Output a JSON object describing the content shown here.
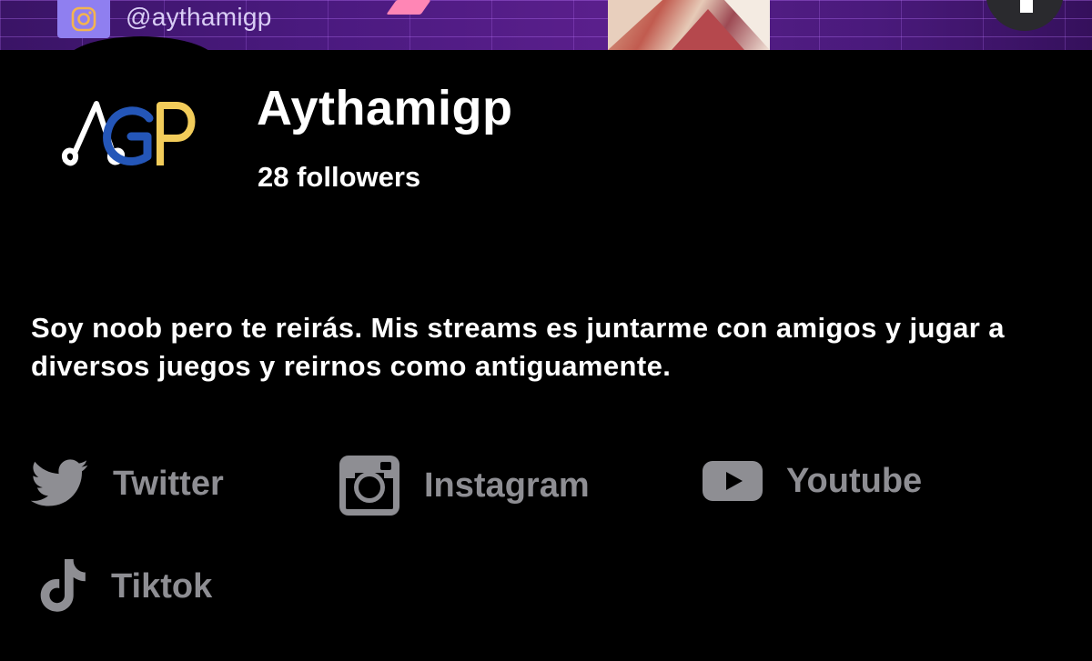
{
  "banner": {
    "instagram_handle": "@aythamigp",
    "colors": {
      "background": "#4b1a80",
      "instagram_tile": "#8f7ff0"
    }
  },
  "profile": {
    "logo_letters": "AGP",
    "name": "Aythamigp",
    "followers": "28 followers",
    "bio": "Soy noob pero te reirás. Mis streams es juntarme con amigos y jugar a diversos juegos y reirnos como antiguamente."
  },
  "socials": [
    {
      "label": "Twitter",
      "icon": "twitter-icon"
    },
    {
      "label": "Instagram",
      "icon": "instagram-icon"
    },
    {
      "label": "Youtube",
      "icon": "youtube-icon"
    },
    {
      "label": "Tiktok",
      "icon": "tiktok-icon"
    }
  ],
  "colors": {
    "background": "#000000",
    "text": "#ffffff",
    "link_gray": "#8e8e93"
  }
}
